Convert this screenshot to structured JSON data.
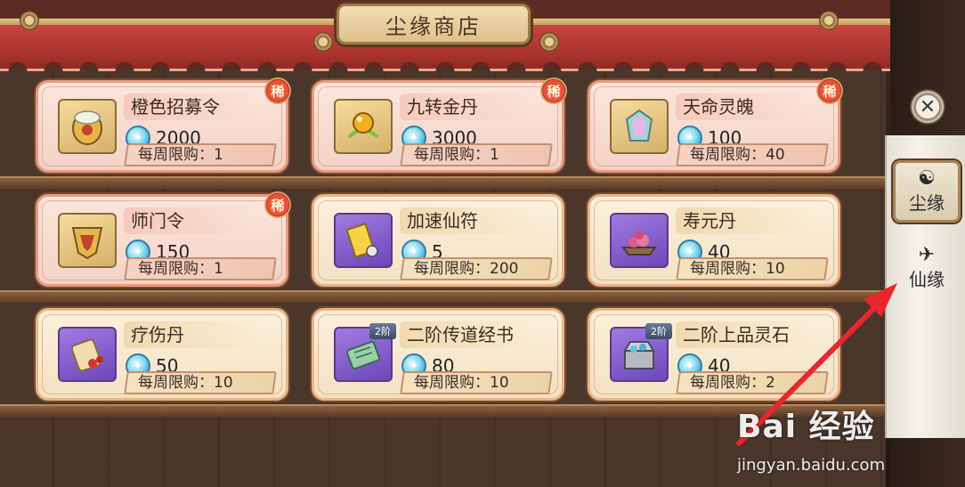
{
  "shop": {
    "title": "尘缘商店",
    "rare_label": "稀",
    "currency_icon": "spirit-currency-icon",
    "items": [
      {
        "name": "橙色招募令",
        "price": "2000",
        "limit": "每周限购：1",
        "rare": true,
        "tier": "",
        "icon": "orange-recruit-token-icon"
      },
      {
        "name": "九转金丹",
        "price": "3000",
        "limit": "每周限购：1",
        "rare": true,
        "tier": "",
        "icon": "golden-pill-icon"
      },
      {
        "name": "天命灵魄",
        "price": "100",
        "limit": "每周限购：40",
        "rare": true,
        "tier": "",
        "icon": "destiny-soul-icon"
      },
      {
        "name": "师门令",
        "price": "150",
        "limit": "每周限购：1",
        "rare": true,
        "tier": "",
        "icon": "sect-token-icon"
      },
      {
        "name": "加速仙符",
        "price": "5",
        "limit": "每周限购：200",
        "rare": false,
        "tier": "",
        "icon": "speed-talisman-icon"
      },
      {
        "name": "寿元丹",
        "price": "40",
        "limit": "每周限购：10",
        "rare": false,
        "tier": "",
        "icon": "longevity-pill-icon"
      },
      {
        "name": "疗伤丹",
        "price": "50",
        "limit": "每周限购：10",
        "rare": false,
        "tier": "",
        "icon": "healing-scroll-icon"
      },
      {
        "name": "二阶传道经书",
        "price": "80",
        "limit": "每周限购：10",
        "rare": false,
        "tier": "2阶",
        "icon": "scripture-scroll-icon"
      },
      {
        "name": "二阶上品灵石",
        "price": "40",
        "limit": "每周限购：2",
        "rare": false,
        "tier": "2阶",
        "icon": "spirit-stone-chest-icon"
      }
    ]
  },
  "side_tabs": [
    {
      "label": "尘缘",
      "active": true,
      "icon": "dust-fate-icon"
    },
    {
      "label": "仙缘",
      "active": false,
      "icon": "immortal-fate-icon"
    }
  ],
  "close_icon": "close-icon",
  "watermark": {
    "main": "Bai 经验",
    "url": "jingyan.baidu.com"
  },
  "colors": {
    "rare_badge": "#e8543a",
    "annotation_arrow": "#e8262e",
    "currency": "#3aa8d0"
  }
}
